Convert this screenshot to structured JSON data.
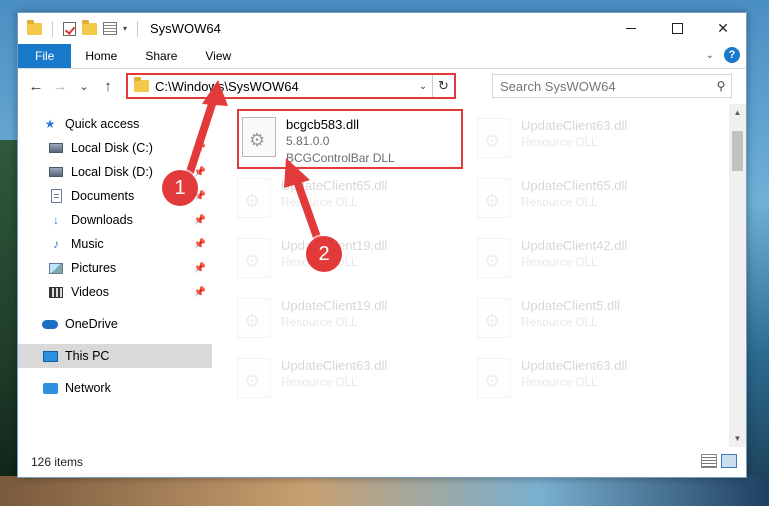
{
  "window": {
    "title": "SysWOW64",
    "minimize": "",
    "maximize": "",
    "close": "✕"
  },
  "ribbon": {
    "tabs": [
      "File",
      "Home",
      "Share",
      "View"
    ],
    "help": "?"
  },
  "navigation": {
    "back": "←",
    "forward": "→",
    "recent": "⌄",
    "up": "↑",
    "address": "C:\\Windows\\SysWOW64",
    "refresh": "↻",
    "search_placeholder": "Search SysWOW64"
  },
  "sidebar": {
    "quick_access": "Quick access",
    "items": [
      {
        "label": "Local Disk (C:)",
        "icon": "drive-icon",
        "pinned": true
      },
      {
        "label": "Local Disk (D:)",
        "icon": "drive-icon",
        "pinned": true
      },
      {
        "label": "Documents",
        "icon": "documents-icon",
        "pinned": true
      },
      {
        "label": "Downloads",
        "icon": "downloads-icon",
        "pinned": true
      },
      {
        "label": "Music",
        "icon": "music-icon",
        "pinned": true
      },
      {
        "label": "Pictures",
        "icon": "pictures-icon",
        "pinned": true
      },
      {
        "label": "Videos",
        "icon": "videos-icon",
        "pinned": true
      }
    ],
    "onedrive": "OneDrive",
    "this_pc": "This PC",
    "network": "Network"
  },
  "files": {
    "highlighted": {
      "name": "bcgcb583.dll",
      "version": "5.81.0.0",
      "description": "BCGControlBar DLL"
    },
    "background": [
      {
        "name": "UpdateClient63.dll",
        "type": "Resource DLL"
      },
      {
        "name": "UpdateClient65.dll",
        "type": "Resource DLL"
      },
      {
        "name": "UpdateClient65.dll",
        "type": "Resource DLL"
      },
      {
        "name": "UpdateClient19.dll",
        "type": "Resource DLL"
      },
      {
        "name": "UpdateClient42.dll",
        "type": "Resource DLL"
      },
      {
        "name": "UpdateClient19.dll",
        "type": "Resource DLL"
      },
      {
        "name": "UpdateClient5.dll",
        "type": "Resource DLL"
      },
      {
        "name": "UpdateClient63.dll",
        "type": "Resource DLL"
      },
      {
        "name": "UpdateClient63.dll",
        "type": "Resource DLL"
      }
    ]
  },
  "status": {
    "item_count": "126 items"
  },
  "callouts": {
    "one": "1",
    "two": "2"
  },
  "colors": {
    "accent": "#1979ca",
    "highlight": "#e23a3a"
  }
}
